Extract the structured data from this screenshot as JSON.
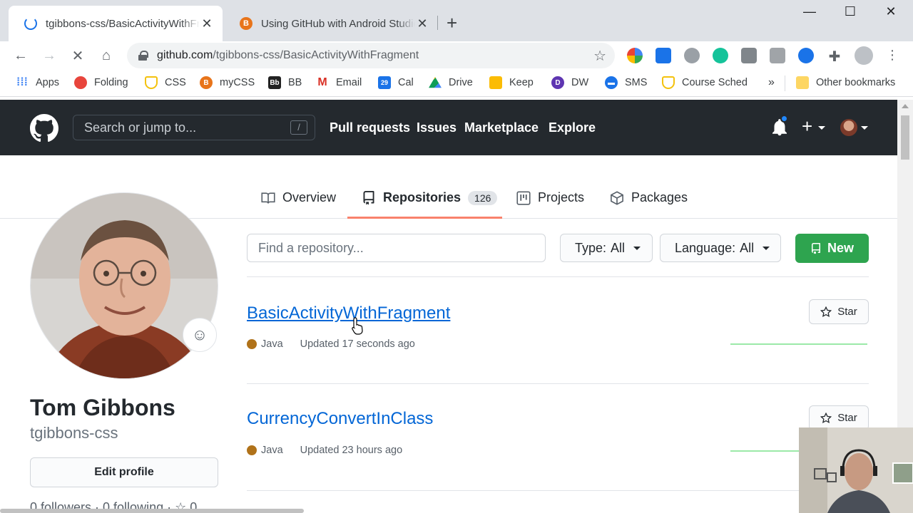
{
  "browser": {
    "tabs": [
      {
        "title": "tgibbons-css/BasicActivityWithFragment",
        "active": true
      },
      {
        "title": "Using GitHub with Android Studio",
        "active": false
      }
    ],
    "url_host": "github.com",
    "url_path": "/tgibbons-css/BasicActivityWithFragment",
    "bookmarks": [
      {
        "label": "Apps",
        "icon": "apps-grid-icon",
        "color": "#4285f4"
      },
      {
        "label": "Folding",
        "icon": "folding-icon",
        "color": "#e8453c"
      },
      {
        "label": "CSS",
        "icon": "shield-icon",
        "color": "#f4c20d"
      },
      {
        "label": "myCSS",
        "icon": "bb-icon",
        "color": "#e8741a"
      },
      {
        "label": "BB",
        "icon": "bb-icon",
        "color": "#222222"
      },
      {
        "label": "Email",
        "icon": "gmail-icon",
        "color": "#d93025"
      },
      {
        "label": "Cal",
        "icon": "calendar-icon",
        "color": "#1a73e8"
      },
      {
        "label": "Drive",
        "icon": "drive-icon",
        "color": "#0f9d58"
      },
      {
        "label": "Keep",
        "icon": "keep-icon",
        "color": "#fbbc04"
      },
      {
        "label": "DW",
        "icon": "dw-icon",
        "color": "#5e35b1"
      },
      {
        "label": "SMS",
        "icon": "sms-icon",
        "color": "#1a73e8"
      },
      {
        "label": "Course Sched",
        "icon": "shield-icon",
        "color": "#f4c20d"
      }
    ],
    "more_bookmarks": "»",
    "other_bookmarks": "Other bookmarks"
  },
  "github": {
    "search_placeholder": "Search or jump to...",
    "search_shortcut": "/",
    "nav": [
      "Pull requests",
      "Issues",
      "Marketplace",
      "Explore"
    ],
    "profile_tabs": [
      {
        "label": "Overview",
        "icon": "book-icon"
      },
      {
        "label": "Repositories",
        "icon": "repo-icon",
        "count": "126",
        "selected": true
      },
      {
        "label": "Projects",
        "icon": "project-icon"
      },
      {
        "label": "Packages",
        "icon": "package-icon"
      }
    ],
    "user": {
      "name": "Tom Gibbons",
      "login": "tgibbons-css",
      "edit_profile": "Edit profile",
      "follow_line": "0 followers · 0 following · ☆ 0"
    },
    "filters": {
      "find_placeholder": "Find a repository...",
      "type_label": "Type:",
      "type_value": "All",
      "language_label": "Language:",
      "language_value": "All",
      "new_label": "New"
    },
    "repos": [
      {
        "name": "BasicActivityWithFragment",
        "language": "Java",
        "updated": "Updated 17 seconds ago",
        "star_label": "Star"
      },
      {
        "name": "CurrencyConvertInClass",
        "language": "Java",
        "updated": "Updated 23 hours ago",
        "star_label": "Star"
      }
    ],
    "colors": {
      "header": "#24292e",
      "link": "#0366d6",
      "green": "#2ea44f",
      "java": "#b07219",
      "tab_accent": "#f9826c"
    }
  }
}
